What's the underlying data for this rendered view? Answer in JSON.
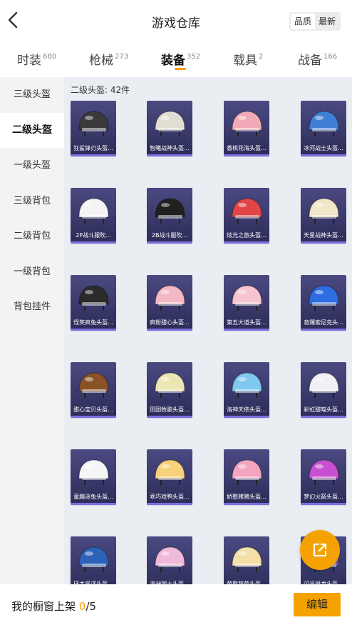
{
  "header": {
    "title": "游戏仓库",
    "toggle": {
      "quality": "品质",
      "newest": "最新",
      "selected": "品质"
    }
  },
  "tabs": [
    {
      "label": "时装",
      "count": "680",
      "active": false
    },
    {
      "label": "枪械",
      "count": "273",
      "active": false
    },
    {
      "label": "装备",
      "count": "352",
      "active": true
    },
    {
      "label": "载具",
      "count": "2",
      "active": false
    },
    {
      "label": "战备",
      "count": "166",
      "active": false
    }
  ],
  "sidebar": {
    "items": [
      {
        "label": "三级头盔",
        "active": false
      },
      {
        "label": "二级头盔",
        "active": true
      },
      {
        "label": "一级头盔",
        "active": false
      },
      {
        "label": "三级背包",
        "active": false
      },
      {
        "label": "二级背包",
        "active": false
      },
      {
        "label": "一级背包",
        "active": false
      },
      {
        "label": "背包挂件",
        "active": false
      }
    ]
  },
  "content": {
    "count_label": "二级头盔: 42件",
    "items": [
      {
        "name": "狂鲨锋刃头盔...",
        "icon": "shark-helmet-icon",
        "color": "#3a3a3a"
      },
      {
        "name": "智曦战神头盔...",
        "icon": "winged-helmet-icon",
        "color": "#e2ddd2"
      },
      {
        "name": "香桃花海头盔...",
        "icon": "peach-helmet-icon",
        "color": "#f2a9b7"
      },
      {
        "name": "冰河战士头盔...",
        "icon": "ice-helmet-icon",
        "color": "#3f7fd6"
      },
      {
        "name": "2P战斗服吹...",
        "icon": "white-helmet-icon",
        "color": "#f4f4f4"
      },
      {
        "name": "2B战斗服吹...",
        "icon": "black-helmet-icon",
        "color": "#202020"
      },
      {
        "name": "炫光之旅头盔...",
        "icon": "red-star-helmet-icon",
        "color": "#e24545"
      },
      {
        "name": "天星战神头盔...",
        "icon": "gold-helmet-icon",
        "color": "#f0e6c8"
      },
      {
        "name": "怪笑疯兔头盔...",
        "icon": "rabbit-helmet-icon",
        "color": "#2a2a2a"
      },
      {
        "name": "疯粉甜心头盔...",
        "icon": "pink-helmet-icon",
        "color": "#f4b8c4"
      },
      {
        "name": "第五大道头盔...",
        "icon": "light-pink-helmet-icon",
        "color": "#f7c5d0"
      },
      {
        "name": "音爆索尼克头...",
        "icon": "sonic-helmet-icon",
        "color": "#2e6de0"
      },
      {
        "name": "甜心宝贝头盔...",
        "icon": "bear-helmet-icon",
        "color": "#8a5226"
      },
      {
        "name": "田园牧歌头盔...",
        "icon": "cream-helmet-icon",
        "color": "#ece6b3"
      },
      {
        "name": "洛神天依头盔...",
        "icon": "tianyi-helmet-icon",
        "color": "#7fc8f0"
      },
      {
        "name": "彩虹甜喵头盔...",
        "icon": "cat-helmet-icon",
        "color": "#f0f0f6"
      },
      {
        "name": "童趣迷兔头盔...",
        "icon": "bunny-helmet-icon",
        "color": "#f6f6f6"
      },
      {
        "name": "乖巧戏鸭头盔...",
        "icon": "duck-helmet-icon",
        "color": "#f7d27a"
      },
      {
        "name": "娇憨猪猪头盔...",
        "icon": "pig-helmet-icon",
        "color": "#f3a5bf"
      },
      {
        "name": "梦幻火箭头盔...",
        "icon": "rocket-helmet-icon",
        "color": "#c74fd1"
      },
      {
        "name": "环太平洋头盔...",
        "icon": "pacific-helmet-icon",
        "color": "#2c62b8"
      },
      {
        "name": "海洲国土头盔...",
        "icon": "kitsune-helmet-icon",
        "color": "#f1b9d9"
      },
      {
        "name": "萌熊萌萌头盔...",
        "icon": "cream-bear-helmet-icon",
        "color": "#f5dfa8"
      },
      {
        "name": "闪光斑龙头盔...",
        "icon": "dino-helmet-icon",
        "color": "#7a5cc0"
      }
    ]
  },
  "bottom_bar": {
    "shelf_label": "我的橱窗上架",
    "shelf_current": "0",
    "shelf_total": "/5",
    "edit_label": "编辑"
  },
  "fab": {
    "icon": "share-external-icon",
    "color": "#f5a200"
  }
}
